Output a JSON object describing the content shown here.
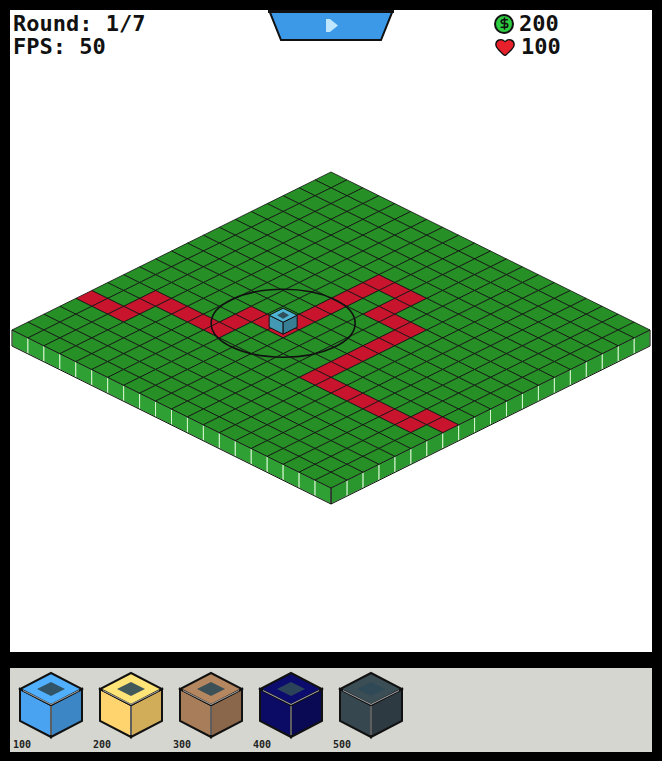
{
  "hud": {
    "round": "Round: 1/7",
    "fps": "FPS: 50",
    "money": "200",
    "health": "100"
  },
  "board": {
    "size": 20,
    "path": [
      [
        0,
        15
      ],
      [
        1,
        15
      ],
      [
        2,
        15
      ],
      [
        2,
        14
      ],
      [
        2,
        13
      ],
      [
        3,
        13
      ],
      [
        4,
        13
      ],
      [
        5,
        13
      ],
      [
        6,
        13
      ],
      [
        6,
        12
      ],
      [
        6,
        11
      ],
      [
        7,
        11
      ],
      [
        8,
        11
      ],
      [
        8,
        10
      ],
      [
        8,
        9
      ],
      [
        8,
        8
      ],
      [
        8,
        7
      ],
      [
        8,
        6
      ],
      [
        8,
        5
      ],
      [
        9,
        5
      ],
      [
        10,
        5
      ],
      [
        10,
        6
      ],
      [
        10,
        7
      ],
      [
        11,
        7
      ],
      [
        12,
        7
      ],
      [
        12,
        8
      ],
      [
        12,
        9
      ],
      [
        12,
        10
      ],
      [
        12,
        11
      ],
      [
        12,
        12
      ],
      [
        12,
        13
      ],
      [
        13,
        13
      ],
      [
        14,
        13
      ],
      [
        15,
        13
      ],
      [
        16,
        13
      ],
      [
        17,
        13
      ],
      [
        18,
        13
      ],
      [
        18,
        12
      ],
      [
        19,
        12
      ]
    ],
    "towers": [
      {
        "col": 7,
        "row": 10,
        "color": "#4fb3d4",
        "selected": true
      }
    ]
  },
  "shop": {
    "items": [
      {
        "price": "100",
        "color": "#4aa3f0"
      },
      {
        "price": "200",
        "color": "#ffd36e"
      },
      {
        "price": "300",
        "color": "#a87d5a"
      },
      {
        "price": "400",
        "color": "#0b0b66"
      },
      {
        "price": "500",
        "color": "#37474f"
      }
    ]
  }
}
